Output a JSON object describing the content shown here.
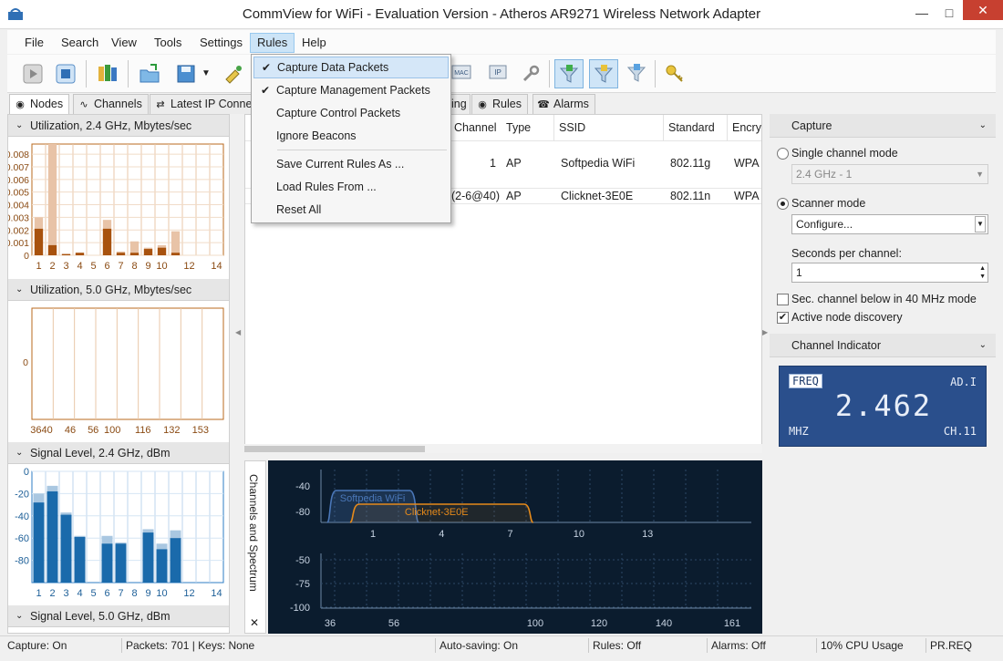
{
  "window": {
    "title": "CommView for WiFi - Evaluation Version - Atheros AR9271 Wireless Network Adapter"
  },
  "menu": [
    "File",
    "Search",
    "View",
    "Tools",
    "Settings",
    "Rules",
    "Help"
  ],
  "rules_menu": {
    "items": [
      {
        "label": "Capture Data Packets",
        "checked": true
      },
      {
        "label": "Capture Management Packets",
        "checked": true
      },
      {
        "label": "Capture Control Packets",
        "checked": false
      },
      {
        "label": "Ignore Beacons",
        "checked": false
      }
    ],
    "items2": [
      {
        "label": "Save Current Rules As ..."
      },
      {
        "label": "Load Rules From ..."
      },
      {
        "label": "Reset All"
      }
    ]
  },
  "toolbar": {
    "icons": [
      "play-icon",
      "stop-icon",
      "open-folder-icon",
      "save-icon",
      "mac-icon",
      "ip-icon",
      "wrench-icon",
      "filter-d-icon",
      "filter-m-icon",
      "filter-c-icon",
      "keys-icon"
    ],
    "mac_label": "MAC",
    "ip_label": "IP"
  },
  "tabs": [
    {
      "label": "Nodes",
      "icon": "nodes-icon"
    },
    {
      "label": "Channels",
      "icon": "channels-icon"
    },
    {
      "label": "Latest IP Connec",
      "icon": "connections-icon"
    },
    {
      "label": "ing",
      "icon": ""
    },
    {
      "label": "Rules",
      "icon": "rules-icon"
    },
    {
      "label": "Alarms",
      "icon": "alarms-icon"
    }
  ],
  "left_sections": {
    "util24": {
      "title": "Utilization, 2.4 GHz, Mbytes/sec",
      "y_ticks": [
        "0.008",
        "0.007",
        "0.006",
        "0.005",
        "0.004",
        "0.003",
        "0.002",
        "0.001",
        "0"
      ],
      "x_ticks": [
        "1",
        "2",
        "3",
        "4",
        "5",
        "6",
        "7",
        "8",
        "9",
        "10",
        "12",
        "14"
      ]
    },
    "util5": {
      "title": "Utilization, 5.0 GHz, Mbytes/sec",
      "y_ticks": [
        "0"
      ],
      "x_ticks": [
        "3640",
        "46",
        "56",
        "100",
        "116",
        "132",
        "153"
      ]
    },
    "signal24": {
      "title": "Signal Level, 2.4 GHz, dBm",
      "y_ticks": [
        "0",
        "-20",
        "-40",
        "-60",
        "-80"
      ],
      "x_ticks": [
        "1",
        "2",
        "3",
        "4",
        "5",
        "6",
        "7",
        "8",
        "9",
        "10",
        "12",
        "14"
      ]
    },
    "signal5": {
      "title": "Signal Level, 5.0 GHz, dBm"
    }
  },
  "chart_data": [
    {
      "type": "bar",
      "title": "Utilization, 2.4 GHz, Mbytes/sec",
      "categories": [
        "1",
        "2",
        "3",
        "4",
        "5",
        "6",
        "7",
        "8",
        "9",
        "10",
        "11",
        "12",
        "13",
        "14"
      ],
      "series": [
        {
          "name": "",
          "values": [
            0.0021,
            0.0008,
            0.0001,
            0.0002,
            0.0,
            0.0021,
            0.0002,
            0.0002,
            0.0005,
            0.0006,
            0.0002,
            0.0,
            0.0,
            0.0
          ]
        },
        {
          "name": "",
          "values": [
            0.003,
            0.0088,
            0.0001,
            0.0002,
            0.0,
            0.0028,
            0.0003,
            0.0011,
            0.0006,
            0.0008,
            0.0019,
            0.0,
            0.0,
            0.0
          ]
        }
      ],
      "ylim": [
        0,
        0.0088
      ]
    },
    {
      "type": "bar",
      "title": "Signal Level, 2.4 GHz, dBm",
      "categories": [
        "1",
        "2",
        "3",
        "4",
        "5",
        "6",
        "7",
        "8",
        "9",
        "10",
        "11",
        "12",
        "13",
        "14"
      ],
      "series": [
        {
          "name": "",
          "values": [
            -28,
            -18,
            -39,
            -59,
            0,
            -65,
            -65,
            0,
            -55,
            -70,
            -60,
            0,
            0,
            0
          ]
        },
        {
          "name": "",
          "values": [
            -20,
            -13,
            -37,
            -58,
            0,
            -58,
            -64,
            0,
            -52,
            -65,
            -53,
            0,
            0,
            0
          ]
        }
      ],
      "ylim": [
        -100,
        0
      ]
    },
    {
      "type": "area",
      "title": "Channels and Spectrum",
      "x": [
        1,
        4,
        7,
        10,
        13
      ],
      "series": [
        {
          "name": "Softpedia WiFi",
          "channel_range": [
            -1,
            3
          ],
          "level": -58
        },
        {
          "name": "Clicknet-3E0E",
          "channel_range": [
            0,
            8
          ],
          "level": -72
        }
      ],
      "y_ticks_24": [
        "-40",
        "-80"
      ],
      "y_ticks_5": [
        "-50",
        "-75",
        "-100"
      ],
      "x_ticks_24": [
        "1",
        "4",
        "7",
        "10",
        "13"
      ],
      "x_ticks_5": [
        "36",
        "56",
        "100",
        "120",
        "140",
        "161"
      ]
    }
  ],
  "spectrum_label": "Channels and Spectrum",
  "table": {
    "columns": [
      "Channel",
      "Type",
      "SSID",
      "Standard",
      "Encry"
    ],
    "rows": [
      {
        "channel": "1",
        "type": "AP",
        "ssid": "Softpedia WiFi",
        "standard": "802.11g",
        "enc": "WPA"
      },
      {
        "channel": "(2-6@40)",
        "type": "AP",
        "ssid": "Clicknet-3E0E",
        "standard": "802.11n",
        "enc": "WPA"
      }
    ]
  },
  "capture_panel": {
    "title": "Capture",
    "single_mode": "Single channel mode",
    "single_value": "2.4 GHz - 1",
    "scanner_mode": "Scanner mode",
    "configure": "Configure...",
    "seconds_label": "Seconds per channel:",
    "seconds_value": "1",
    "sec_channel": "Sec. channel below in 40 MHz mode",
    "active_discovery": "Active node discovery"
  },
  "indicator": {
    "title": "Channel Indicator",
    "freq_tag": "FREQ",
    "ad_tag": "AD.I",
    "value": "2.462",
    "mhz_tag": "MHZ",
    "ch_tag": "CH.11"
  },
  "status": {
    "capture": "Capture: On",
    "packets": "Packets: 701 | Keys: None",
    "autosave": "Auto-saving: On",
    "rules": "Rules: Off",
    "alarms": "Alarms: Off",
    "cpu": "10% CPU Usage",
    "prreq": "PR.REQ"
  },
  "colors": {
    "util_dark": "#a8520e",
    "util_light": "#e8c3a7",
    "signal_dark": "#1a6aab",
    "signal_light": "#a9c7e1",
    "spectrum_bg": "#0b1c2e",
    "softpedia": "#4a77b8",
    "clicknet": "#e68a1a"
  }
}
